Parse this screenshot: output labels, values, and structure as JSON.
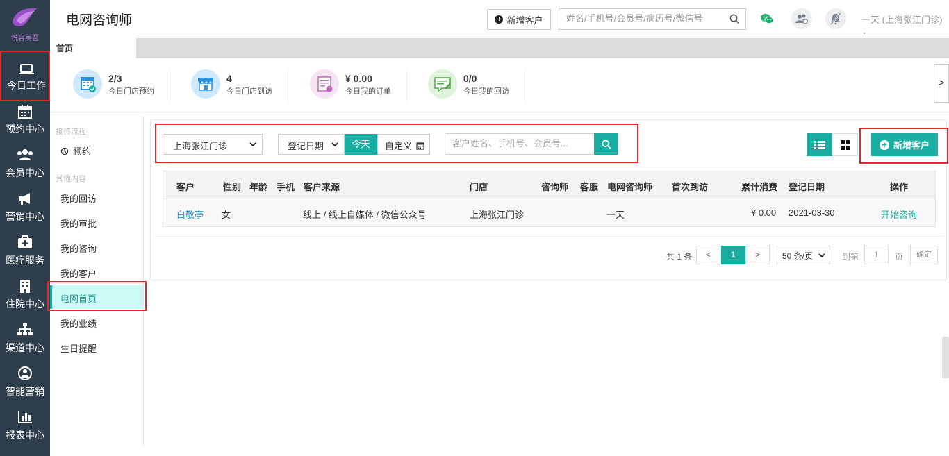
{
  "brand": {
    "logo_text": "悦容美吾"
  },
  "sidebar": {
    "items": [
      {
        "label": "今日工作",
        "icon": "laptop-icon"
      },
      {
        "label": "预约中心",
        "icon": "calendar-icon"
      },
      {
        "label": "会员中心",
        "icon": "users-icon"
      },
      {
        "label": "营销中心",
        "icon": "megaphone-icon"
      },
      {
        "label": "医疗服务",
        "icon": "medical-kit-icon"
      },
      {
        "label": "住院中心",
        "icon": "building-icon"
      },
      {
        "label": "渠道中心",
        "icon": "sitemap-icon"
      },
      {
        "label": "智能营销",
        "icon": "person-target-icon"
      },
      {
        "label": "报表中心",
        "icon": "bar-chart-icon"
      }
    ]
  },
  "header": {
    "title": "电网咨询师",
    "add_customer": "新增客户",
    "search_placeholder": "姓名/手机号/会员号/病历号/微信号",
    "user": "一天 (上海张江门诊)"
  },
  "tabs": {
    "home": "首页"
  },
  "stats": [
    {
      "value": "2/3",
      "caption": "今日门店预约",
      "color": "#cfe8fb",
      "icon": "calendar-check-icon"
    },
    {
      "value": "4",
      "caption": "今日门店到访",
      "color": "#cfe8fb",
      "icon": "storefront-icon"
    },
    {
      "value": "¥ 0.00",
      "caption": "今日我的订单",
      "color": "#f6e4f4",
      "icon": "order-icon"
    },
    {
      "value": "0/0",
      "caption": "今日我的回访",
      "color": "#dff2dc",
      "icon": "message-edit-icon"
    }
  ],
  "stats_next": ">",
  "subnav": {
    "group1": "接待流程",
    "reception": "预约",
    "group2": "其他内容",
    "items": [
      "我的回访",
      "我的审批",
      "我的咨询",
      "我的客户",
      "电网首页",
      "我的业绩",
      "生日提醒"
    ]
  },
  "filters": {
    "store": "上海张江门诊",
    "date_type": "登记日期",
    "today": "今天",
    "custom": "自定义",
    "search_placeholder": "客户姓名、手机号、会员号...",
    "add_customer": "新增客户"
  },
  "table": {
    "headers": [
      "客户",
      "性别",
      "年龄",
      "手机",
      "客户来源",
      "门店",
      "咨询师",
      "客服",
      "电网咨询师",
      "首次到访",
      "累计消费",
      "登记日期",
      "操作"
    ],
    "rows": [
      [
        "白敬亭",
        "女",
        "",
        "",
        "线上 / 线上自媒体 / 微信公众号",
        "上海张江门诊",
        "",
        "",
        "一天",
        "",
        "¥ 0.00",
        "2021-03-30",
        "开始咨询"
      ]
    ]
  },
  "pagination": {
    "total": "共 1 条",
    "prev": "<",
    "current": "1",
    "next": ">",
    "page_size": "50 条/页",
    "goto": "到第",
    "goto_value": "1",
    "page_unit": "页",
    "confirm": "确定"
  }
}
